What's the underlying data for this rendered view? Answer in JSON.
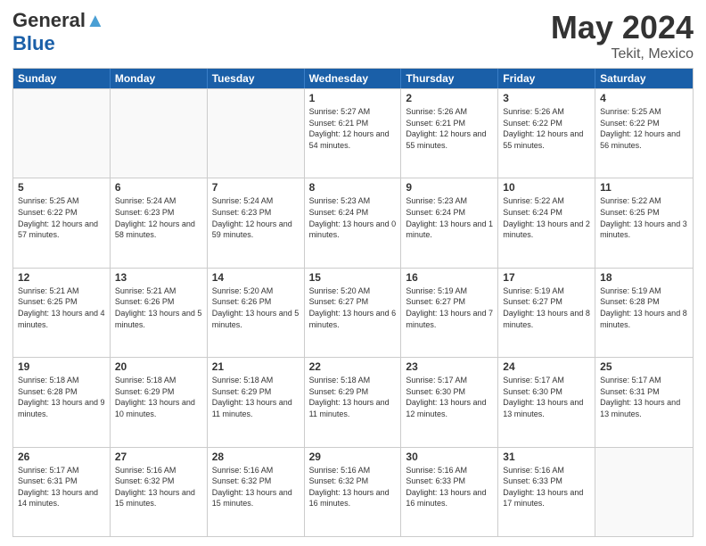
{
  "header": {
    "logo_line1": "General",
    "logo_line2": "Blue",
    "title": "May 2024",
    "location": "Tekit, Mexico"
  },
  "days_of_week": [
    "Sunday",
    "Monday",
    "Tuesday",
    "Wednesday",
    "Thursday",
    "Friday",
    "Saturday"
  ],
  "weeks": [
    [
      {
        "day": "",
        "sunrise": "",
        "sunset": "",
        "daylight": "",
        "empty": true
      },
      {
        "day": "",
        "sunrise": "",
        "sunset": "",
        "daylight": "",
        "empty": true
      },
      {
        "day": "",
        "sunrise": "",
        "sunset": "",
        "daylight": "",
        "empty": true
      },
      {
        "day": "1",
        "sunrise": "Sunrise: 5:27 AM",
        "sunset": "Sunset: 6:21 PM",
        "daylight": "Daylight: 12 hours and 54 minutes.",
        "empty": false
      },
      {
        "day": "2",
        "sunrise": "Sunrise: 5:26 AM",
        "sunset": "Sunset: 6:21 PM",
        "daylight": "Daylight: 12 hours and 55 minutes.",
        "empty": false
      },
      {
        "day": "3",
        "sunrise": "Sunrise: 5:26 AM",
        "sunset": "Sunset: 6:22 PM",
        "daylight": "Daylight: 12 hours and 55 minutes.",
        "empty": false
      },
      {
        "day": "4",
        "sunrise": "Sunrise: 5:25 AM",
        "sunset": "Sunset: 6:22 PM",
        "daylight": "Daylight: 12 hours and 56 minutes.",
        "empty": false
      }
    ],
    [
      {
        "day": "5",
        "sunrise": "Sunrise: 5:25 AM",
        "sunset": "Sunset: 6:22 PM",
        "daylight": "Daylight: 12 hours and 57 minutes.",
        "empty": false
      },
      {
        "day": "6",
        "sunrise": "Sunrise: 5:24 AM",
        "sunset": "Sunset: 6:23 PM",
        "daylight": "Daylight: 12 hours and 58 minutes.",
        "empty": false
      },
      {
        "day": "7",
        "sunrise": "Sunrise: 5:24 AM",
        "sunset": "Sunset: 6:23 PM",
        "daylight": "Daylight: 12 hours and 59 minutes.",
        "empty": false
      },
      {
        "day": "8",
        "sunrise": "Sunrise: 5:23 AM",
        "sunset": "Sunset: 6:24 PM",
        "daylight": "Daylight: 13 hours and 0 minutes.",
        "empty": false
      },
      {
        "day": "9",
        "sunrise": "Sunrise: 5:23 AM",
        "sunset": "Sunset: 6:24 PM",
        "daylight": "Daylight: 13 hours and 1 minute.",
        "empty": false
      },
      {
        "day": "10",
        "sunrise": "Sunrise: 5:22 AM",
        "sunset": "Sunset: 6:24 PM",
        "daylight": "Daylight: 13 hours and 2 minutes.",
        "empty": false
      },
      {
        "day": "11",
        "sunrise": "Sunrise: 5:22 AM",
        "sunset": "Sunset: 6:25 PM",
        "daylight": "Daylight: 13 hours and 3 minutes.",
        "empty": false
      }
    ],
    [
      {
        "day": "12",
        "sunrise": "Sunrise: 5:21 AM",
        "sunset": "Sunset: 6:25 PM",
        "daylight": "Daylight: 13 hours and 4 minutes.",
        "empty": false
      },
      {
        "day": "13",
        "sunrise": "Sunrise: 5:21 AM",
        "sunset": "Sunset: 6:26 PM",
        "daylight": "Daylight: 13 hours and 5 minutes.",
        "empty": false
      },
      {
        "day": "14",
        "sunrise": "Sunrise: 5:20 AM",
        "sunset": "Sunset: 6:26 PM",
        "daylight": "Daylight: 13 hours and 5 minutes.",
        "empty": false
      },
      {
        "day": "15",
        "sunrise": "Sunrise: 5:20 AM",
        "sunset": "Sunset: 6:27 PM",
        "daylight": "Daylight: 13 hours and 6 minutes.",
        "empty": false
      },
      {
        "day": "16",
        "sunrise": "Sunrise: 5:19 AM",
        "sunset": "Sunset: 6:27 PM",
        "daylight": "Daylight: 13 hours and 7 minutes.",
        "empty": false
      },
      {
        "day": "17",
        "sunrise": "Sunrise: 5:19 AM",
        "sunset": "Sunset: 6:27 PM",
        "daylight": "Daylight: 13 hours and 8 minutes.",
        "empty": false
      },
      {
        "day": "18",
        "sunrise": "Sunrise: 5:19 AM",
        "sunset": "Sunset: 6:28 PM",
        "daylight": "Daylight: 13 hours and 8 minutes.",
        "empty": false
      }
    ],
    [
      {
        "day": "19",
        "sunrise": "Sunrise: 5:18 AM",
        "sunset": "Sunset: 6:28 PM",
        "daylight": "Daylight: 13 hours and 9 minutes.",
        "empty": false
      },
      {
        "day": "20",
        "sunrise": "Sunrise: 5:18 AM",
        "sunset": "Sunset: 6:29 PM",
        "daylight": "Daylight: 13 hours and 10 minutes.",
        "empty": false
      },
      {
        "day": "21",
        "sunrise": "Sunrise: 5:18 AM",
        "sunset": "Sunset: 6:29 PM",
        "daylight": "Daylight: 13 hours and 11 minutes.",
        "empty": false
      },
      {
        "day": "22",
        "sunrise": "Sunrise: 5:18 AM",
        "sunset": "Sunset: 6:29 PM",
        "daylight": "Daylight: 13 hours and 11 minutes.",
        "empty": false
      },
      {
        "day": "23",
        "sunrise": "Sunrise: 5:17 AM",
        "sunset": "Sunset: 6:30 PM",
        "daylight": "Daylight: 13 hours and 12 minutes.",
        "empty": false
      },
      {
        "day": "24",
        "sunrise": "Sunrise: 5:17 AM",
        "sunset": "Sunset: 6:30 PM",
        "daylight": "Daylight: 13 hours and 13 minutes.",
        "empty": false
      },
      {
        "day": "25",
        "sunrise": "Sunrise: 5:17 AM",
        "sunset": "Sunset: 6:31 PM",
        "daylight": "Daylight: 13 hours and 13 minutes.",
        "empty": false
      }
    ],
    [
      {
        "day": "26",
        "sunrise": "Sunrise: 5:17 AM",
        "sunset": "Sunset: 6:31 PM",
        "daylight": "Daylight: 13 hours and 14 minutes.",
        "empty": false
      },
      {
        "day": "27",
        "sunrise": "Sunrise: 5:16 AM",
        "sunset": "Sunset: 6:32 PM",
        "daylight": "Daylight: 13 hours and 15 minutes.",
        "empty": false
      },
      {
        "day": "28",
        "sunrise": "Sunrise: 5:16 AM",
        "sunset": "Sunset: 6:32 PM",
        "daylight": "Daylight: 13 hours and 15 minutes.",
        "empty": false
      },
      {
        "day": "29",
        "sunrise": "Sunrise: 5:16 AM",
        "sunset": "Sunset: 6:32 PM",
        "daylight": "Daylight: 13 hours and 16 minutes.",
        "empty": false
      },
      {
        "day": "30",
        "sunrise": "Sunrise: 5:16 AM",
        "sunset": "Sunset: 6:33 PM",
        "daylight": "Daylight: 13 hours and 16 minutes.",
        "empty": false
      },
      {
        "day": "31",
        "sunrise": "Sunrise: 5:16 AM",
        "sunset": "Sunset: 6:33 PM",
        "daylight": "Daylight: 13 hours and 17 minutes.",
        "empty": false
      },
      {
        "day": "",
        "sunrise": "",
        "sunset": "",
        "daylight": "",
        "empty": true
      }
    ]
  ]
}
